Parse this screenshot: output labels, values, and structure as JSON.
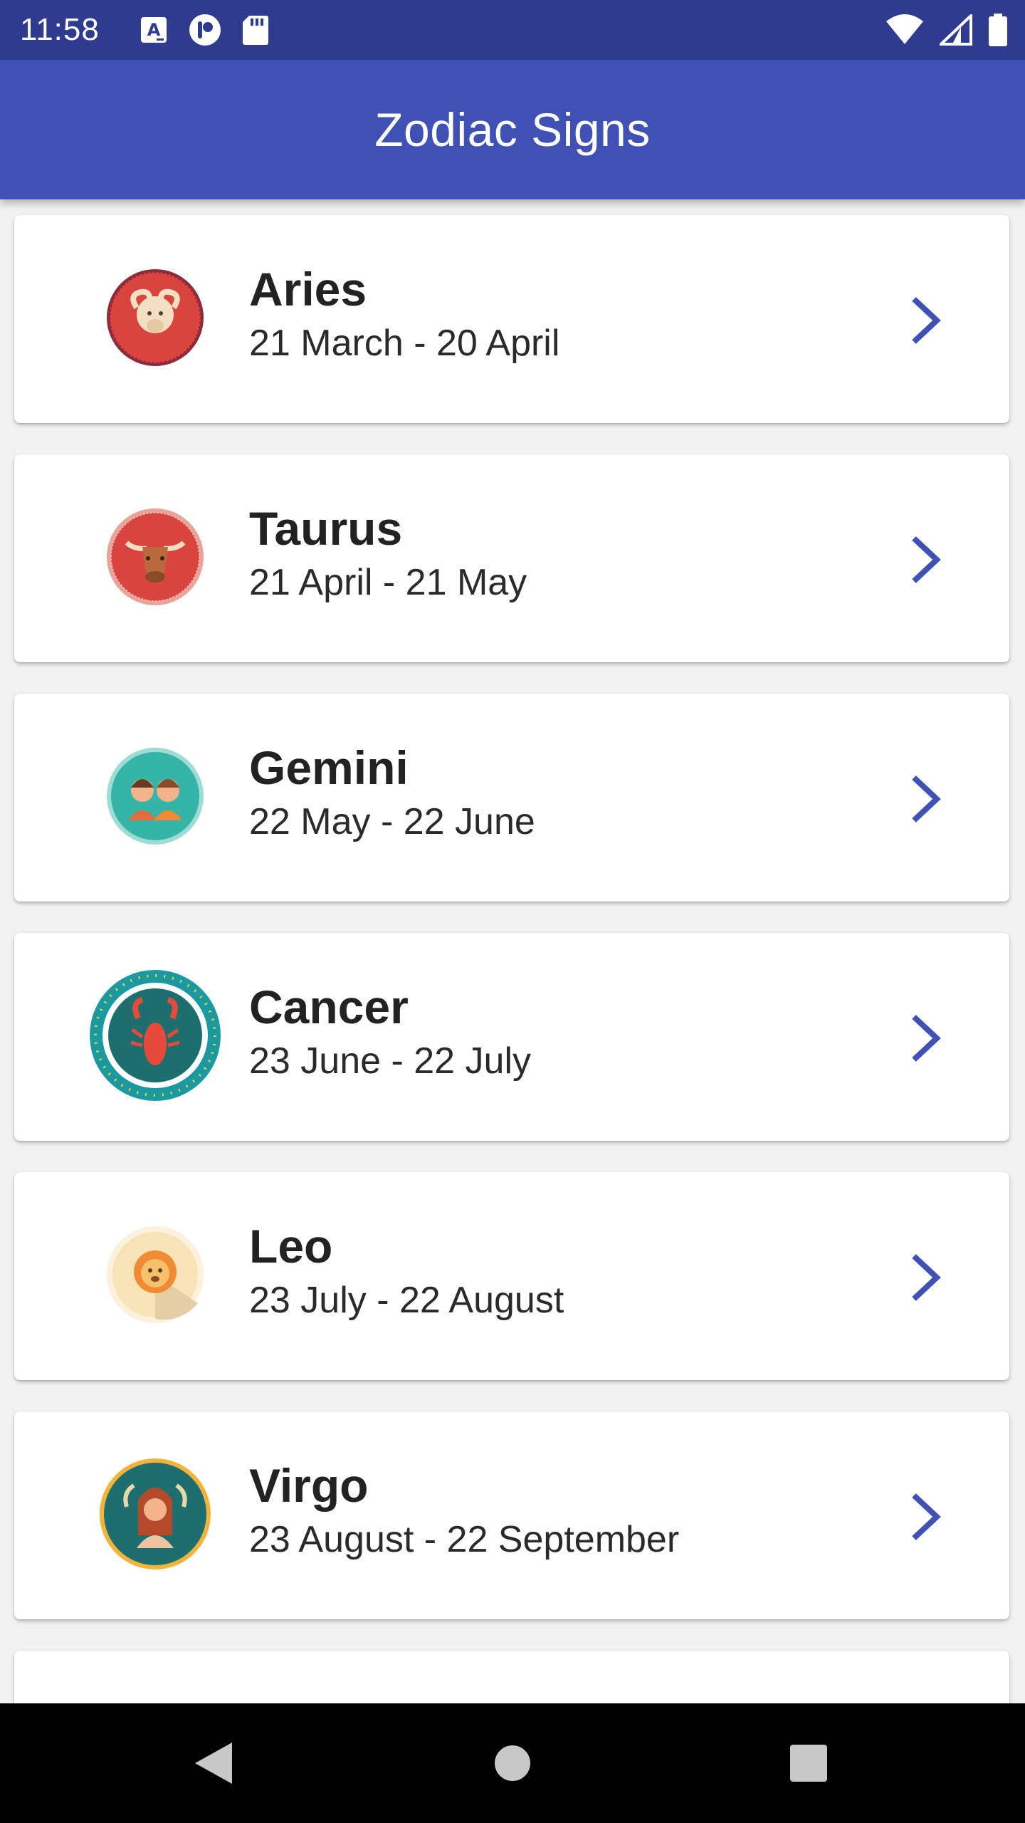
{
  "status_bar": {
    "time": "11:58",
    "left_icons": [
      "text-notification-icon",
      "privacy-notification-icon",
      "sd-card-icon"
    ],
    "right_icons": [
      "wifi-icon",
      "cell-signal-icon",
      "battery-icon"
    ]
  },
  "app_bar": {
    "title": "Zodiac Signs",
    "color": "#3f51b5"
  },
  "signs": [
    {
      "name": "Aries",
      "dates": "21 March - 20 April",
      "icon": "aries-ram-icon"
    },
    {
      "name": "Taurus",
      "dates": "21 April - 21 May",
      "icon": "taurus-bull-icon"
    },
    {
      "name": "Gemini",
      "dates": "22 May - 22 June",
      "icon": "gemini-twins-icon"
    },
    {
      "name": "Cancer",
      "dates": "23 June - 22 July",
      "icon": "cancer-crab-icon"
    },
    {
      "name": "Leo",
      "dates": "23 July - 22 August",
      "icon": "leo-lion-icon"
    },
    {
      "name": "Virgo",
      "dates": "23 August - 22 September",
      "icon": "virgo-maiden-icon"
    },
    {
      "name": "",
      "dates": "",
      "icon": "partial-sign-icon"
    }
  ],
  "chevron_color": "#3f51b5",
  "nav_bar": {
    "buttons": [
      "back-icon",
      "home-icon",
      "recents-icon"
    ]
  }
}
